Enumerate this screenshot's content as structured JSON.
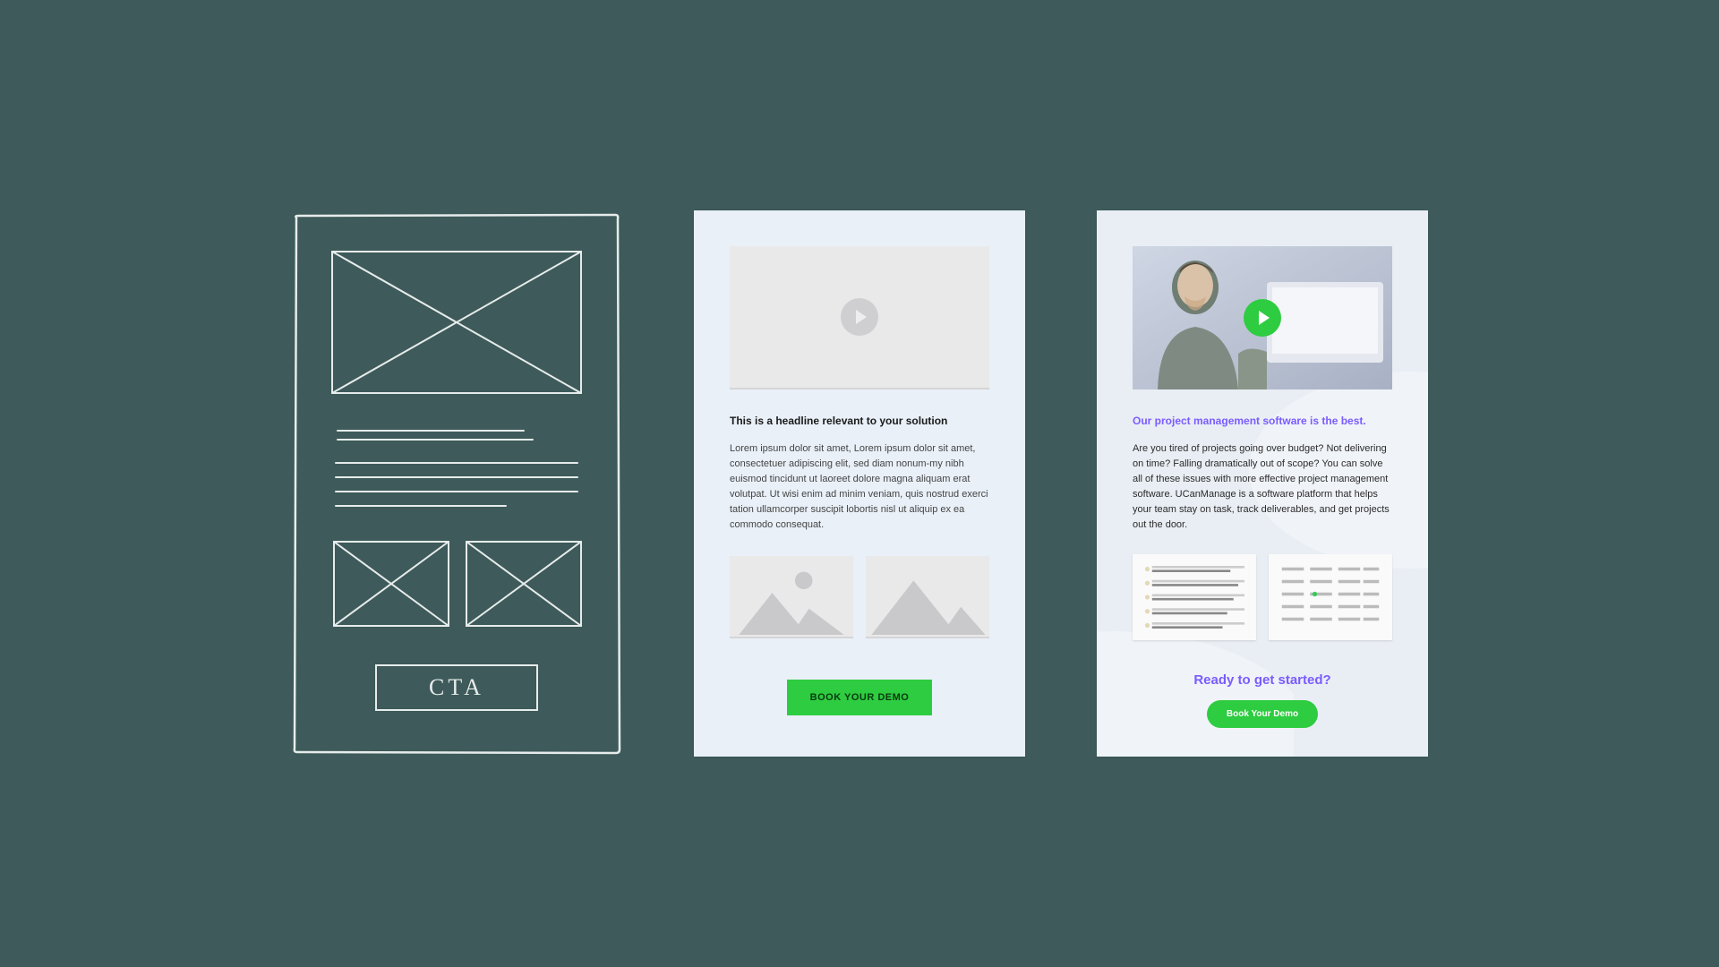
{
  "panel1": {
    "cta_label": "CTA"
  },
  "panel2": {
    "headline": "This is a headline relevant to your solution",
    "body": "Lorem ipsum dolor sit amet, Lorem ipsum dolor sit amet, consectetuer adipiscing elit, sed diam nonum-my nibh euismod tincidunt ut laoreet dolore magna aliquam erat volutpat. Ut wisi enim ad minim veniam, quis nostrud exerci tation ullamcorper suscipit lobortis nisl ut aliquip ex ea commodo consequat.",
    "cta_label": "BOOK YOUR DEMO"
  },
  "panel3": {
    "headline": "Our project management software is the best.",
    "body": "Are you tired of projects going over budget? Not delivering on time? Falling dramatically out of scope? You can solve all of these issues with more effective project management software. UCanManage is a software platform that helps your team stay on task, track deliverables, and get projects out the door.",
    "ready_heading": "Ready to get started?",
    "cta_label": "Book Your Demo"
  }
}
